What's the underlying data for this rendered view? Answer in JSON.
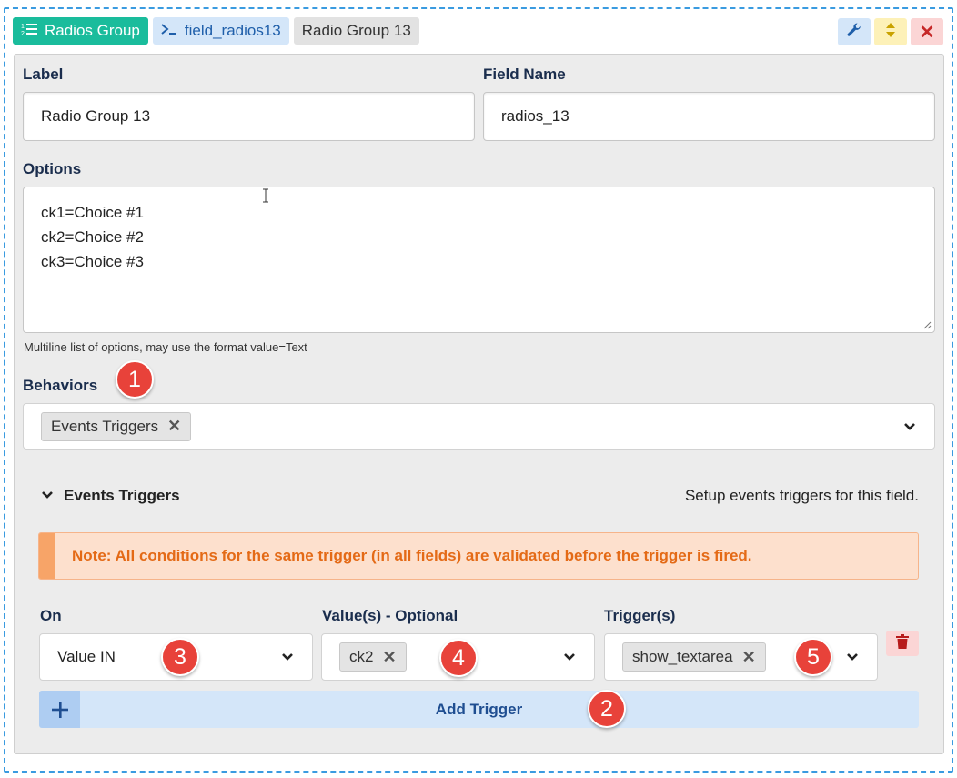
{
  "header": {
    "type_icon": "list-ordered-icon",
    "type_label": "Radios Group",
    "field_icon": "terminal-icon",
    "field_name": "field_radios13",
    "label": "Radio Group 13",
    "settings_icon": "wrench-icon",
    "move_icon": "sort-arrows-icon",
    "remove_icon": "close-icon",
    "remove_glyph": "✕"
  },
  "form": {
    "label_title": "Label",
    "label_value": "Radio Group 13",
    "fieldname_title": "Field Name",
    "fieldname_value": "radios_13",
    "options_title": "Options",
    "options_lines": [
      "ck1=Choice #1",
      "ck2=Choice #2",
      "ck3=Choice #3"
    ],
    "options_help": "Multiline list of options, may use the format value=Text",
    "behaviors_title": "Behaviors",
    "behaviors_selected": "Events Triggers"
  },
  "events": {
    "section_title": "Events Triggers",
    "section_hint": "Setup events triggers for this field.",
    "note": "Note: All conditions for the same trigger (in all fields) are validated before the trigger is fired.",
    "col_on": "On",
    "col_values": "Value(s) - Optional",
    "col_triggers": "Trigger(s)",
    "row": {
      "on_value": "Value IN",
      "values_chip": "ck2",
      "trigger_chip": "show_textarea"
    },
    "add_trigger": "Add Trigger",
    "add_glyph": "+"
  },
  "badges": [
    "1",
    "2",
    "3",
    "4",
    "5"
  ],
  "colors": {
    "accent_teal": "#1abc9c",
    "accent_blue": "#1f4e91",
    "note_orange": "#e46a16",
    "badge_red": "#e8423a",
    "danger": "#c62828"
  }
}
